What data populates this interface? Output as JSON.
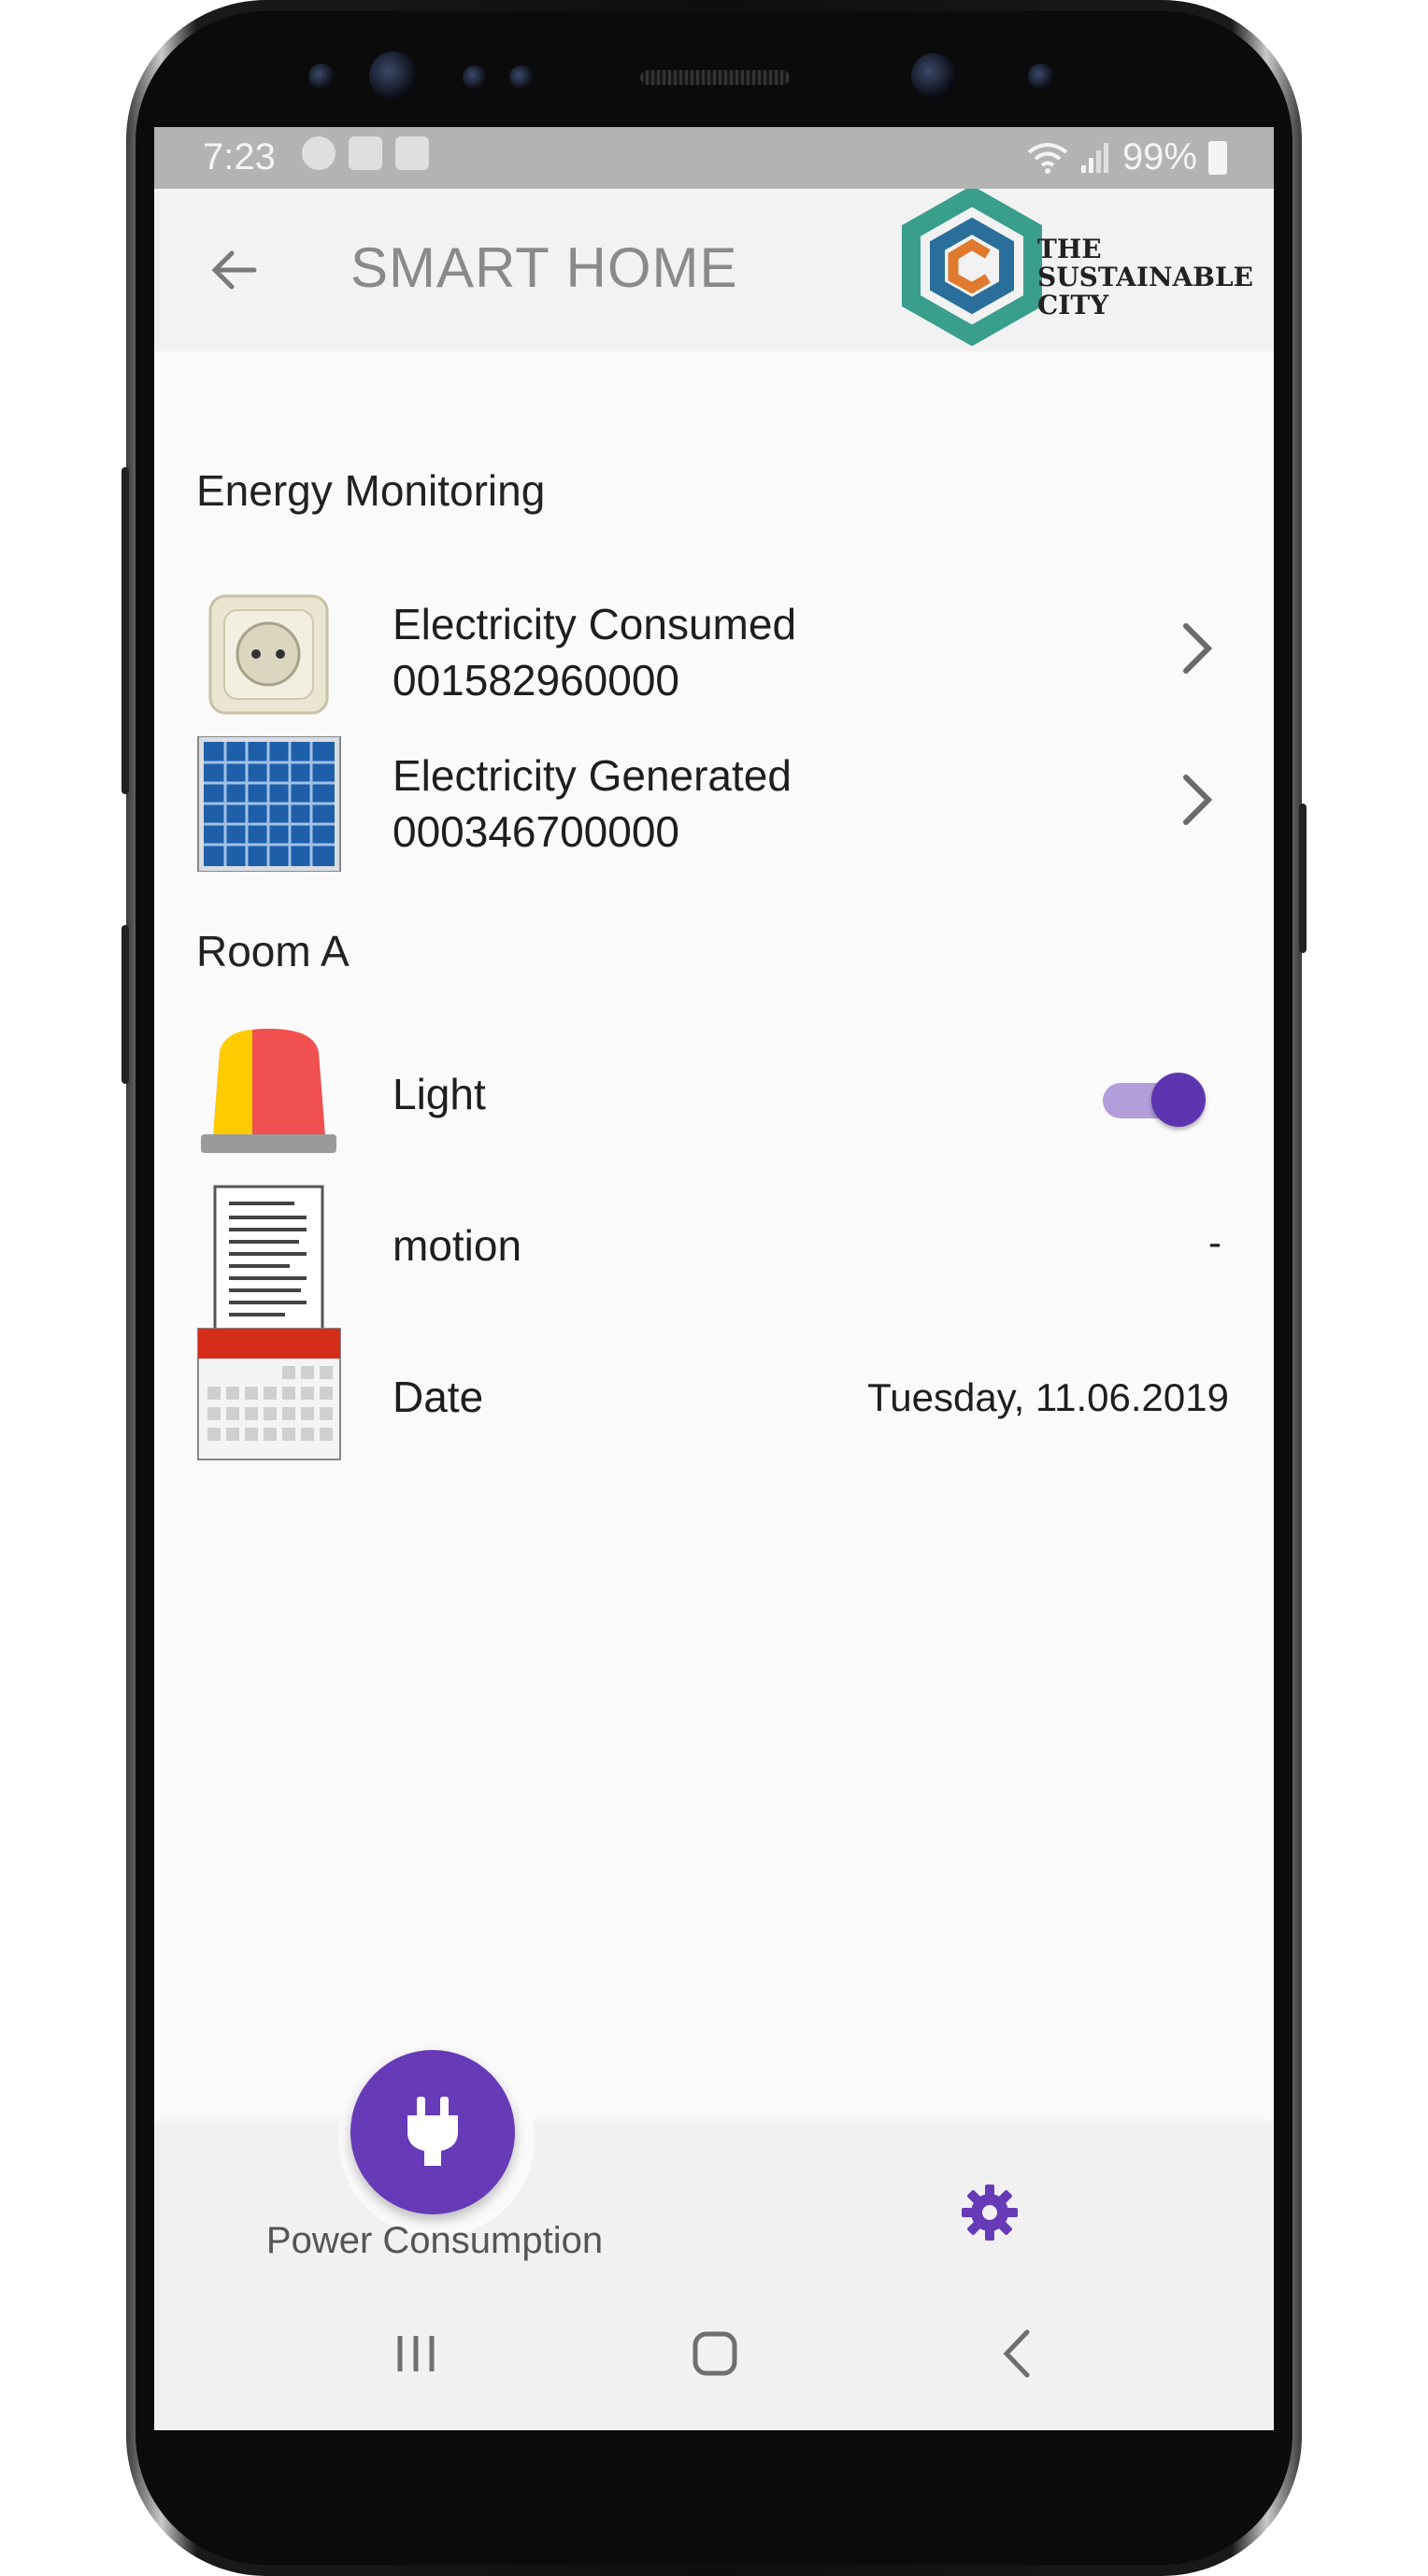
{
  "status_bar": {
    "time": "7:23",
    "battery": "99%",
    "icons": [
      "spotify-icon",
      "ml-app-icon",
      "image-icon",
      "wifi-icon",
      "signal-icon",
      "battery-icon"
    ]
  },
  "app_bar": {
    "title": "SMART HOME",
    "logo_line1": "THE",
    "logo_line2": "SUSTAINABLE",
    "logo_line3": "CITY",
    "logo_colors": {
      "teal": "#3a9e8c",
      "blue": "#2a6f9b",
      "orange": "#e07a2e"
    }
  },
  "sections": {
    "energy": {
      "title": "Energy Monitoring",
      "consumed_label": "Electricity Consumed",
      "consumed_value": "001582960000",
      "generated_label": "Electricity Generated",
      "generated_value": "000346700000"
    },
    "room": {
      "title": "Room A",
      "light_label": "Light",
      "light_on": true,
      "motion_label": "motion",
      "motion_value": "-",
      "date_label": "Date",
      "date_value": "Tuesday, 11.06.2019"
    }
  },
  "bottom_nav": {
    "power_label": "Power Consumption",
    "accent": "#673ab7"
  }
}
